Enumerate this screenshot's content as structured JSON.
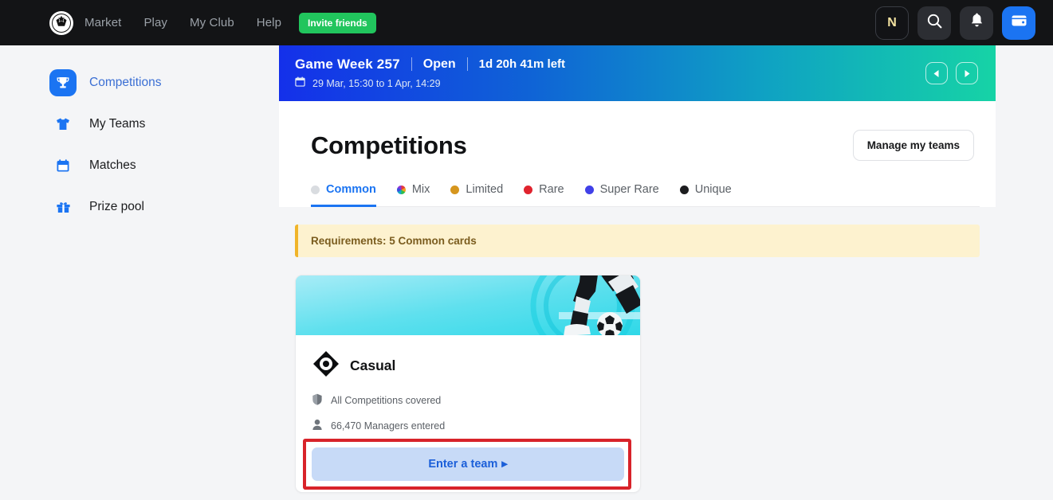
{
  "topnav": {
    "logo_icon": "soccer-ball-logo",
    "links": [
      {
        "label": "Market"
      },
      {
        "label": "Play"
      },
      {
        "label": "My Club"
      },
      {
        "label": "Help"
      }
    ],
    "invite_label": "Invite friends",
    "actions": [
      {
        "name": "notifications-n-badge",
        "label": "N"
      },
      {
        "name": "search-icon",
        "label": ""
      },
      {
        "name": "bell-icon",
        "label": ""
      },
      {
        "name": "wallet-icon",
        "label": ""
      }
    ]
  },
  "sidebar": {
    "items": [
      {
        "label": "Competitions",
        "icon": "trophy-icon",
        "active": true
      },
      {
        "label": "My Teams",
        "icon": "jersey-icon",
        "active": false
      },
      {
        "label": "Matches",
        "icon": "calendar-icon",
        "active": false
      },
      {
        "label": "Prize pool",
        "icon": "gift-icon",
        "active": false
      }
    ]
  },
  "gameweek": {
    "title": "Game Week 257",
    "status": "Open",
    "time_left": "1d 20h 41m left",
    "dates": "29 Mar, 15:30 to 1 Apr, 14:29",
    "calendar_icon": "calendar-icon",
    "prev_label": "◀",
    "next_label": "▶"
  },
  "main": {
    "page_title": "Competitions",
    "manage_button": "Manage my teams",
    "tabs": [
      {
        "label": "Common",
        "color": "#d9dce0",
        "active": true
      },
      {
        "label": "Mix",
        "color": "mix",
        "active": false
      },
      {
        "label": "Limited",
        "color": "#d6961e",
        "active": false
      },
      {
        "label": "Rare",
        "color": "#e0232e",
        "active": false
      },
      {
        "label": "Super Rare",
        "color": "#4040e8",
        "active": false
      },
      {
        "label": "Unique",
        "color": "#1c1d1f",
        "active": false
      }
    ],
    "requirements": "Requirements: 5 Common cards",
    "cards": [
      {
        "title": "Casual",
        "logo_icon": "diamond-eye-logo",
        "coverage": "All Competitions covered",
        "coverage_icon": "shield-icon",
        "managers": "66,470 Managers entered",
        "managers_icon": "person-icon",
        "cta": "Enter a team",
        "cta_arrow": "▸",
        "banner_image": "soccer-player-kicking-ball"
      }
    ]
  },
  "colors": {
    "accent": "#1b74f2",
    "nav_bg": "#131416",
    "invite_green": "#21c55d",
    "highlight_red": "#d8232a",
    "req_bg": "#fdf2cf",
    "req_border": "#f0b429",
    "cta_bg": "#c7daf7"
  }
}
